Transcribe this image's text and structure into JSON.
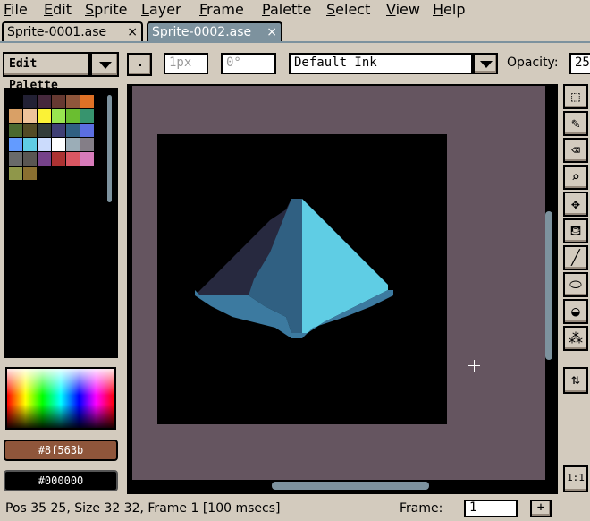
{
  "menu": {
    "items": [
      "File",
      "Edit",
      "Sprite",
      "Layer",
      "Frame",
      "Palette",
      "Select",
      "View",
      "Help"
    ]
  },
  "tabs": [
    {
      "label": "Sprite-0001.ase",
      "close": "×",
      "active": false
    },
    {
      "label": "Sprite-0002.ase",
      "close": "×",
      "active": true
    }
  ],
  "toolbar": {
    "edit_palette_label": "Edit Palette",
    "brush_size": "1px",
    "brush_angle": "0°",
    "ink_mode": "Default Ink",
    "opacity_label": "Opacity:",
    "opacity_value": "25"
  },
  "palette": {
    "colors": [
      "#000000",
      "#222034",
      "#45283c",
      "#663931",
      "#8f563b",
      "#df7126",
      "#d9a066",
      "#eec39a",
      "#fbf236",
      "#99e550",
      "#6abe30",
      "#37946e",
      "#4b692f",
      "#524b24",
      "#323c39",
      "#3f3f74",
      "#306082",
      "#5b6ee1",
      "#639bff",
      "#5fcde4",
      "#cbdbfc",
      "#ffffff",
      "#9badb7",
      "#847e87",
      "#696a6a",
      "#595652",
      "#76428a",
      "#ac3232",
      "#d95763",
      "#d77bba",
      "#8f974a",
      "#8a6f30"
    ],
    "foreground_hex": "#8f563b",
    "background_hex": "#000000"
  },
  "tools": [
    "rectangular-marquee",
    "pencil",
    "eraser",
    "zoom",
    "move",
    "paint-bucket",
    "line",
    "ellipse",
    "contour",
    "spray"
  ],
  "tool_glyphs": [
    "⬚",
    "✎",
    "⌫",
    "⌕",
    "✥",
    "⛾",
    "╱",
    "⬭",
    "◒",
    "⁂"
  ],
  "options_glyph": "⇅",
  "zoom_glyph": "1:1",
  "status": {
    "text": "Pos 35 25, Size 32 32, Frame 1 [100 msecs]",
    "frame_label": "Frame:",
    "frame_value": "1",
    "add_frame": "+"
  }
}
